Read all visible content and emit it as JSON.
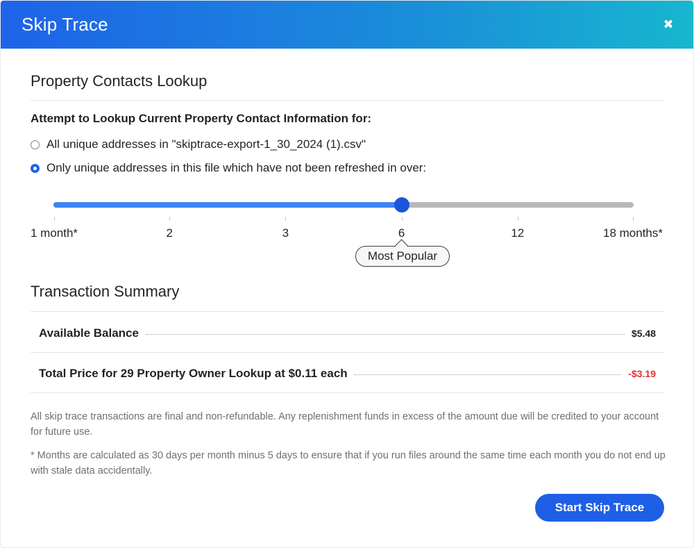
{
  "header": {
    "title": "Skip Trace",
    "close_glyph": "✖"
  },
  "lookup": {
    "section_title": "Property Contacts Lookup",
    "subheading": "Attempt to Lookup Current Property Contact Information for:",
    "options": [
      {
        "label": "All unique addresses in \"skiptrace-export-1_30_2024 (1).csv\"",
        "selected": false
      },
      {
        "label": "Only unique addresses in this file which have not been refreshed in over:",
        "selected": true
      }
    ]
  },
  "slider": {
    "stops": [
      "1 month*",
      "2",
      "3",
      "6",
      "12",
      "18 months*"
    ],
    "selected_index": 3,
    "badge": "Most Popular",
    "colors": {
      "fill": "#3f84f5",
      "track": "#b7b9bd",
      "thumb": "#1c55d8"
    }
  },
  "summary": {
    "section_title": "Transaction Summary",
    "rows": [
      {
        "label": "Available Balance",
        "value": "$5.48",
        "negative": false
      },
      {
        "label": "Total Price for 29 Property Owner Lookup at $0.11 each",
        "value": "-$3.19",
        "negative": true
      }
    ]
  },
  "notes": [
    "All skip trace transactions are final and non-refundable. Any replenishment funds in excess of the amount due will be credited to your account for future use.",
    "* Months are calculated as 30 days per month minus 5 days to ensure that if you run files around the same time each month you do not end up with stale data accidentally."
  ],
  "actions": {
    "start_label": "Start Skip Trace"
  },
  "icons": {
    "close": "close-icon",
    "radio": "radio-icon"
  }
}
